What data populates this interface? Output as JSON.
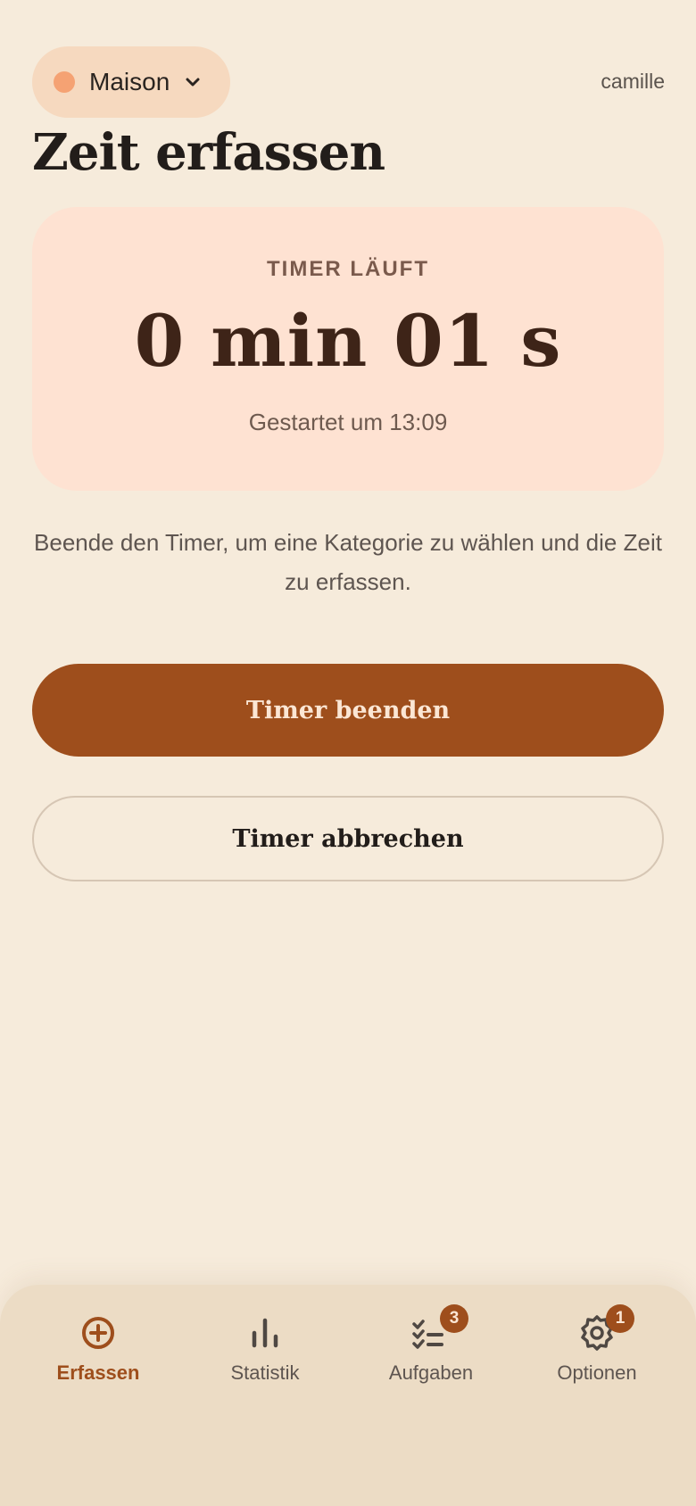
{
  "header": {
    "workspace": {
      "name": "Maison",
      "dot_color": "#f5a273"
    },
    "username": "camille"
  },
  "page_title": "Zeit erfassen",
  "timer": {
    "status": "TIMER LÄUFT",
    "value": "0 min 01 s",
    "started": "Gestartet um 13:09"
  },
  "hint": "Beende den Timer, um eine Kategorie zu wählen und die Zeit zu erfassen.",
  "actions": {
    "stop_label": "Timer beenden",
    "cancel_label": "Timer abbrechen"
  },
  "nav": {
    "items": [
      {
        "label": "Erfassen",
        "icon": "plus-circle-icon",
        "active": true
      },
      {
        "label": "Statistik",
        "icon": "bar-chart-icon"
      },
      {
        "label": "Aufgaben",
        "icon": "task-list-icon",
        "badge": "3"
      },
      {
        "label": "Optionen",
        "icon": "gear-icon",
        "badge": "1"
      }
    ]
  },
  "colors": {
    "background": "#f6ebdb",
    "accent": "#9e4e1c",
    "timer_card": "#fee2d2",
    "workspace_pill": "#f6d9bf"
  }
}
